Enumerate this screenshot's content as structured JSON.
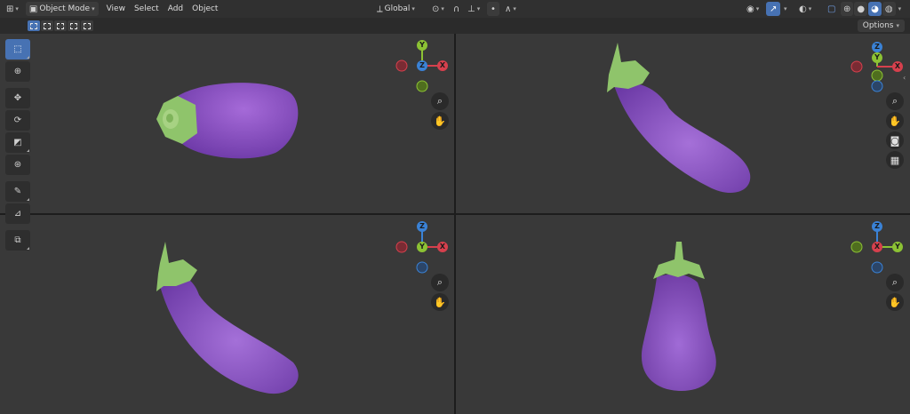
{
  "header": {
    "mode_label": "Object Mode",
    "menus": [
      "View",
      "Select",
      "Add",
      "Object"
    ],
    "transform_orientation": "Global"
  },
  "tool_settings": {
    "options_label": "Options"
  },
  "icons": {
    "editor_type": "cube-grid-icon",
    "mode": "object-mode-icon",
    "orientation": "axes-icon",
    "pivot": "pivot-point-icon",
    "snap": "magnet-icon",
    "proportional": "proportional-edit-icon",
    "visibility": "eye-icon",
    "gizmo": "gizmo-icon",
    "overlay": "overlay-icon",
    "xray": "xray-icon",
    "shading_wire": "wireframe-sphere-icon",
    "shading_solid": "solid-sphere-icon",
    "shading_material": "material-sphere-icon",
    "shading_render": "rendered-sphere-icon"
  },
  "gizmo_axes": {
    "x": "X",
    "y": "Y",
    "z": "Z",
    "colors": {
      "x": "#d6404d",
      "y": "#8cc234",
      "z": "#3a82d6"
    }
  },
  "colors": {
    "accent": "#4772b3",
    "eggplant": "#8a4fc7",
    "stem": "#8cc46a",
    "viewport_bg": "#393939"
  }
}
